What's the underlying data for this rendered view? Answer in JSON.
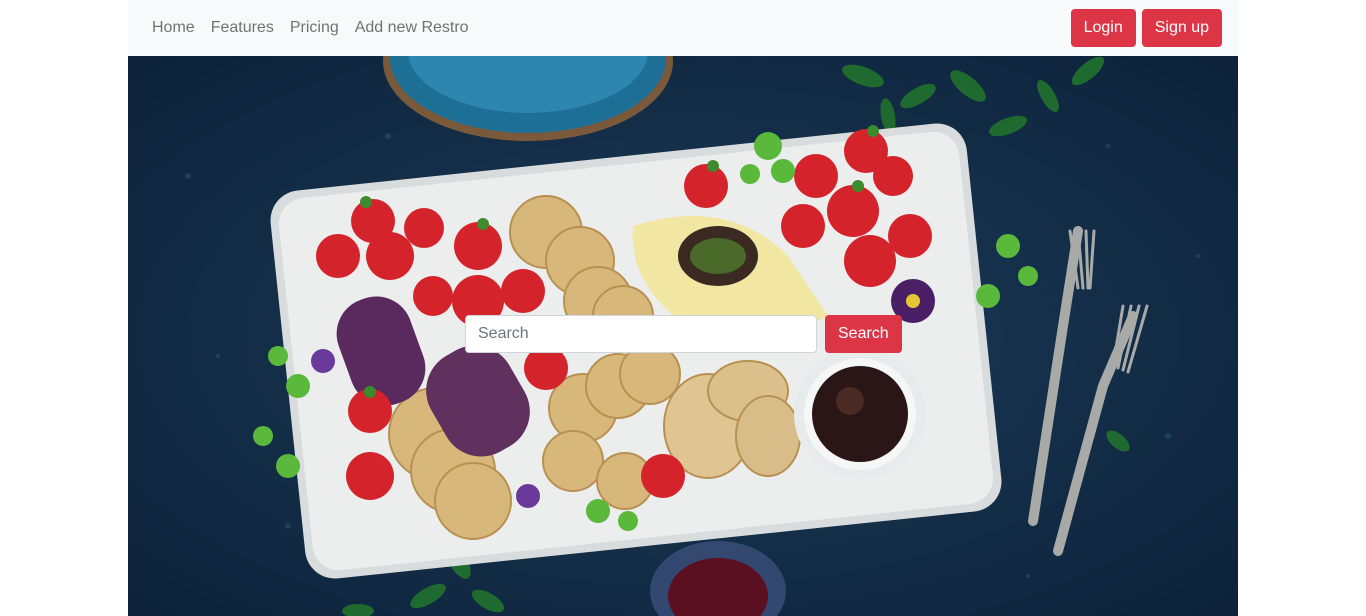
{
  "navbar": {
    "links": [
      {
        "label": "Home"
      },
      {
        "label": "Features"
      },
      {
        "label": "Pricing"
      },
      {
        "label": "Add new Restro"
      }
    ],
    "login_label": "Login",
    "signup_label": "Sign up"
  },
  "search": {
    "placeholder": "Search",
    "value": "",
    "button_label": "Search"
  },
  "colors": {
    "accent": "#dc3545",
    "navbar_bg": "#f8f9fa",
    "link": "#6c757d"
  }
}
